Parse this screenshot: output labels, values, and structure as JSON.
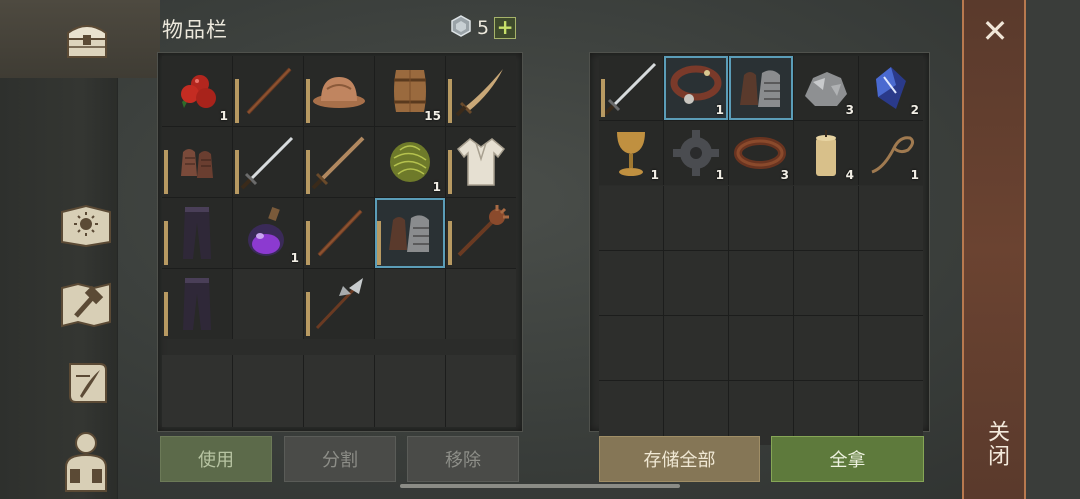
{
  "inventory": {
    "title": "物品栏",
    "currency_count": "5",
    "plus_label": "+"
  },
  "player_items": [
    [
      {
        "icon": "apples-icon",
        "qty": "1",
        "durability": false
      },
      {
        "icon": "staff-icon",
        "qty": "",
        "durability": true
      },
      {
        "icon": "helmet-icon",
        "qty": "",
        "durability": true
      },
      {
        "icon": "barrel-icon",
        "qty": "15",
        "durability": false
      },
      {
        "icon": "saber-icon",
        "qty": "",
        "durability": true
      }
    ],
    [
      {
        "icon": "chainmail-gloves-icon",
        "qty": "",
        "durability": true
      },
      {
        "icon": "sword-icon",
        "qty": "",
        "durability": true
      },
      {
        "icon": "wooden-sword-icon",
        "qty": "",
        "durability": true
      },
      {
        "icon": "herb-bundle-icon",
        "qty": "1",
        "durability": false
      },
      {
        "icon": "shirt-icon",
        "qty": "",
        "durability": true
      }
    ],
    [
      {
        "icon": "pants-icon",
        "qty": "",
        "durability": true
      },
      {
        "icon": "potion-icon",
        "qty": "1",
        "durability": false
      },
      {
        "icon": "staff-icon",
        "qty": "",
        "durability": true
      },
      {
        "icon": "gauntlets-icon",
        "qty": "",
        "durability": true,
        "selected": true
      },
      {
        "icon": "mace-icon",
        "qty": "",
        "durability": true
      }
    ],
    [
      {
        "icon": "pants-icon",
        "qty": "",
        "durability": true
      },
      {
        "icon": "",
        "qty": "",
        "durability": false
      },
      {
        "icon": "halberd-icon",
        "qty": "",
        "durability": true
      },
      {
        "icon": "",
        "qty": "",
        "durability": false
      },
      {
        "icon": "",
        "qty": "",
        "durability": false
      }
    ]
  ],
  "storage_items": [
    [
      {
        "icon": "sword-icon",
        "qty": "",
        "durability": true
      },
      {
        "icon": "collar-icon",
        "qty": "1",
        "durability": false,
        "selected": true
      },
      {
        "icon": "gauntlets-icon",
        "qty": "",
        "durability": false,
        "selected": true
      },
      {
        "icon": "ore-icon",
        "qty": "3",
        "durability": false
      },
      {
        "icon": "crystal-icon",
        "qty": "2",
        "durability": false
      }
    ],
    [
      {
        "icon": "goblet-icon",
        "qty": "1",
        "durability": false
      },
      {
        "icon": "gear-icon",
        "qty": "1",
        "durability": false
      },
      {
        "icon": "leather-icon",
        "qty": "3",
        "durability": false
      },
      {
        "icon": "candle-icon",
        "qty": "4",
        "durability": false
      },
      {
        "icon": "rope-icon",
        "qty": "1",
        "durability": false
      }
    ]
  ],
  "buttons": {
    "use": "使用",
    "split": "分割",
    "remove": "移除",
    "store_all": "存储全部",
    "take_all": "全拿"
  },
  "close": {
    "x": "✕",
    "label": "关闭"
  }
}
